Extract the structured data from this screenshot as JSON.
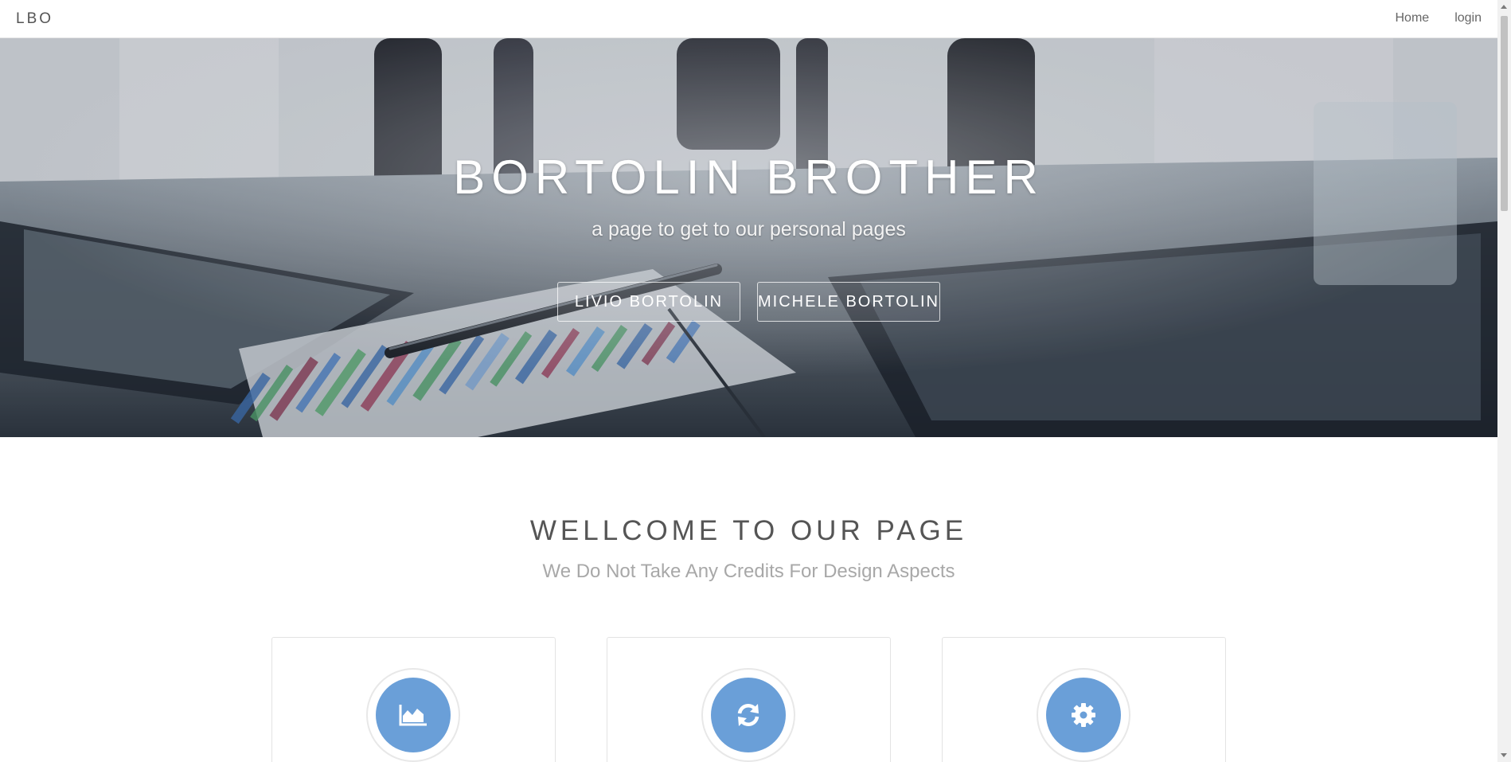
{
  "navbar": {
    "brand": "LBO",
    "links": [
      "Home",
      "login"
    ]
  },
  "hero": {
    "title": "BORTOLIN BROTHER",
    "subtitle": "a page to get to our personal pages",
    "buttons": [
      "LIVIO BORTOLIN",
      "MICHELE BORTOLIN"
    ]
  },
  "welcome": {
    "title": "WELLCOME TO OUR PAGE",
    "subtitle": "We Do Not Take Any Credits For Design Aspects"
  },
  "cards": [
    {
      "icon": "area-chart-icon"
    },
    {
      "icon": "refresh-icon"
    },
    {
      "icon": "gear-icon"
    }
  ],
  "colors": {
    "accent": "#6a9fd8",
    "text": "#555555",
    "muted": "#a8a8a8"
  }
}
